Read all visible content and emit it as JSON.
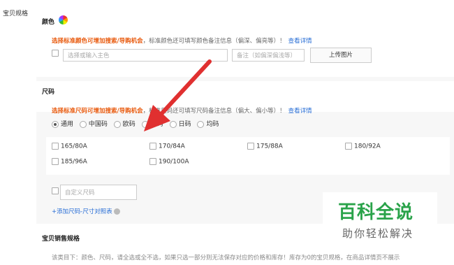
{
  "left_label": "宝贝规格",
  "color_section": {
    "title": "颜色",
    "hint_emphasis": "选择标准颜色可增加搜索/导购机会",
    "hint_rest": "，标准颜色还可填写颜色备注信息（偏深、偏亮等）！",
    "hint_link": "查看详情",
    "main_color_placeholder": "选择或输入主色",
    "remark_placeholder": "备注（如偏深偏浅等）",
    "upload_label": "上传图片"
  },
  "size_section": {
    "title": "尺码",
    "hint_emphasis": "选择标准尺码可增加搜索/导购机会",
    "hint_rest": "，标准尺码还可填写尺码备注信息（偏大、偏小等）！",
    "hint_link": "查看详情",
    "radio_options": [
      "通用",
      "中国码",
      "欧码",
      "英码",
      "日码",
      "均码"
    ],
    "selected_radio": "通用",
    "size_options": [
      "165/80A",
      "170/84A",
      "175/88A",
      "180/92A",
      "185/96A",
      "190/100A"
    ],
    "custom_placeholder": "自定义尺码",
    "add_link": "+添加尺码-尺寸对照表"
  },
  "sales_section": {
    "title": "宝贝销售规格",
    "note": "该类目下：颜色、尺码，请全选或全不选，如果只选一部分则无法保存对应的价格和库存！库存为0的宝贝规格，在商品详情页不展示"
  },
  "watermark": {
    "line1": "百科全说",
    "line2": "助你轻松解决",
    "color": "#2aa34a"
  },
  "annotation_arrow_color": "#e03030"
}
